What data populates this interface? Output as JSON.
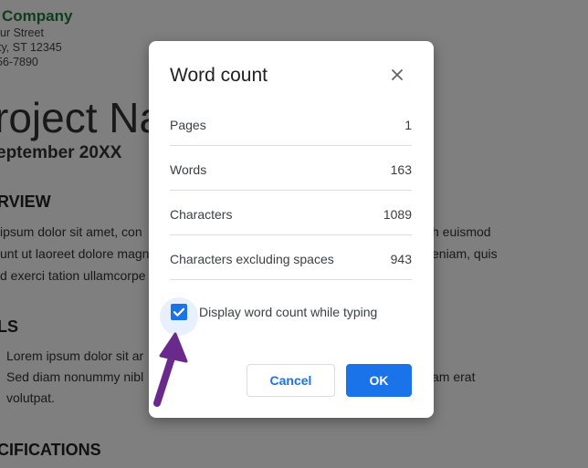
{
  "document": {
    "company": "Company",
    "address_lines": [
      "ur Street",
      "ty, ST 12345",
      "56-7890"
    ],
    "title": "roject Na",
    "date": "eptember 20XX",
    "overview_heading": "RVIEW",
    "overview_left": [
      "ipsum dolor sit amet, con",
      "unt ut laoreet dolore magn",
      "d exerci tation ullamcorpe"
    ],
    "overview_right": [
      "h euismod",
      "eniam, quis"
    ],
    "goals_heading": "LS",
    "goals_left": [
      "Lorem ipsum dolor sit ar",
      "Sed diam nonummy nibl",
      "volutpat."
    ],
    "goals_right": [
      "am erat"
    ],
    "spec_heading": "CIFICATIONS"
  },
  "dialog": {
    "title": "Word count",
    "stats": [
      {
        "label": "Pages",
        "value": "1"
      },
      {
        "label": "Words",
        "value": "163"
      },
      {
        "label": "Characters",
        "value": "1089"
      },
      {
        "label": "Characters excluding spaces",
        "value": "943"
      }
    ],
    "checkbox": {
      "label": "Display word count while typing",
      "checked": true
    },
    "cancel_label": "Cancel",
    "ok_label": "OK"
  },
  "icons": {
    "close": "close-icon",
    "check": "checkmark-icon",
    "arrow": "annotation-arrow-icon"
  },
  "colors": {
    "accent": "#1a73e8",
    "company": "#1e7a3c",
    "arrow": "#6a2a8c"
  }
}
